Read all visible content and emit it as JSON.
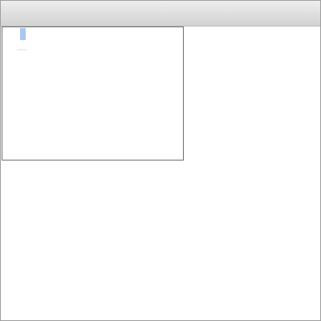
{
  "window": {
    "title": ""
  },
  "editor": {
    "content": "",
    "selection_color": "#a8c8f0"
  },
  "colors": {
    "titlebar_top": "#eeeeee",
    "titlebar_bottom": "#d3d3d3",
    "window_border": "#9e9e9e",
    "editor_border": "#6f6f6f",
    "background": "#ffffff"
  }
}
